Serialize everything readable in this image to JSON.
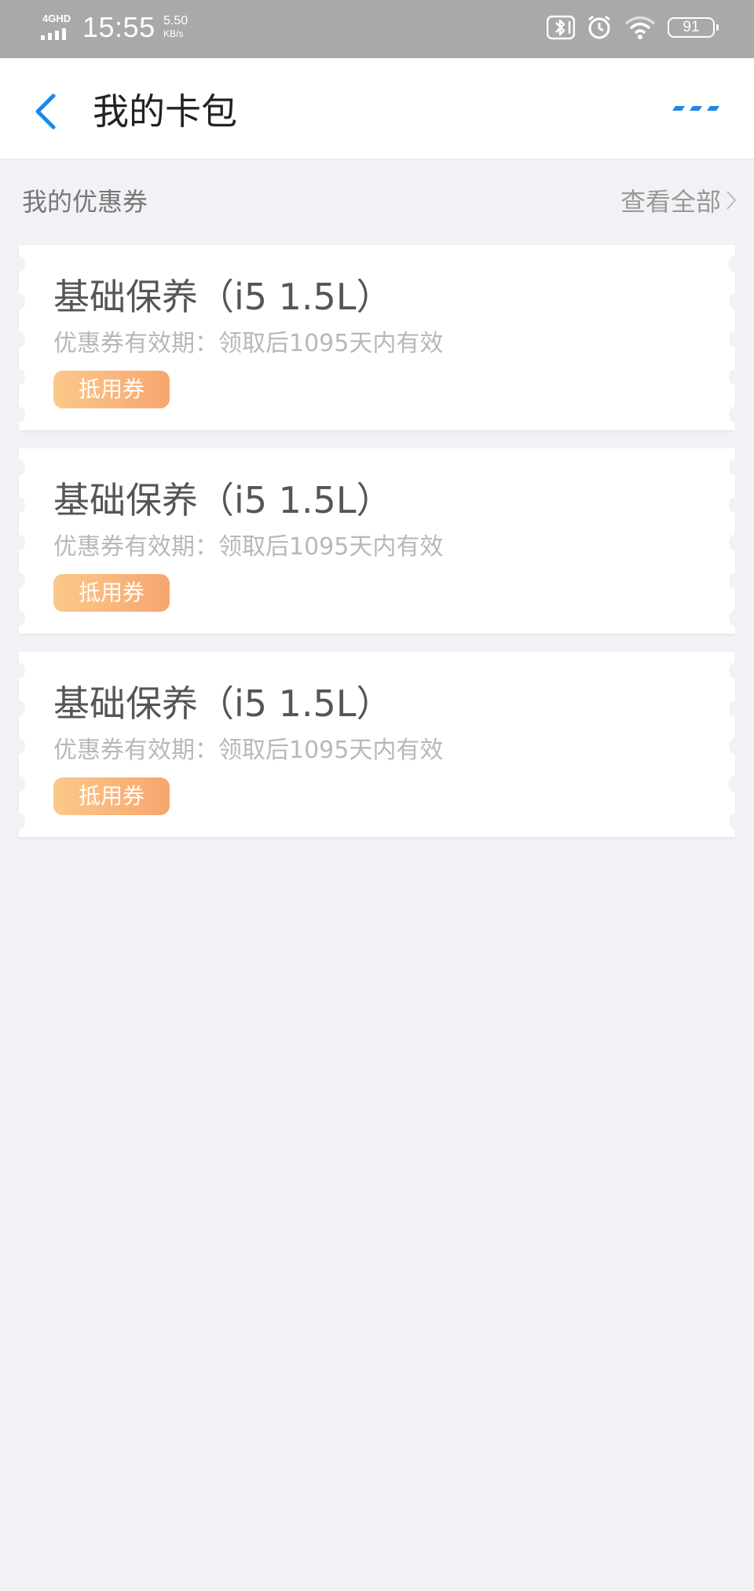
{
  "status_bar": {
    "network": "4GHD",
    "time": "15:55",
    "speed_value": "5.50",
    "speed_unit": "KB/s",
    "battery": "91",
    "icons": [
      "bluetooth-icon",
      "alarm-icon",
      "wifi-icon",
      "battery-icon"
    ]
  },
  "header": {
    "title": "我的卡包",
    "back_icon": "chevron-left-icon",
    "more_icon": "more-dots-icon",
    "accent_color": "#1e88e5"
  },
  "section": {
    "title": "我的优惠券",
    "view_all": "查看全部"
  },
  "coupons": [
    {
      "title": "基础保养（i5 1.5L）",
      "validity": "优惠券有效期：领取后1095天内有效",
      "badge": "抵用券"
    },
    {
      "title": "基础保养（i5 1.5L）",
      "validity": "优惠券有效期：领取后1095天内有效",
      "badge": "抵用券"
    },
    {
      "title": "基础保养（i5 1.5L）",
      "validity": "优惠券有效期：领取后1095天内有效",
      "badge": "抵用券"
    }
  ]
}
